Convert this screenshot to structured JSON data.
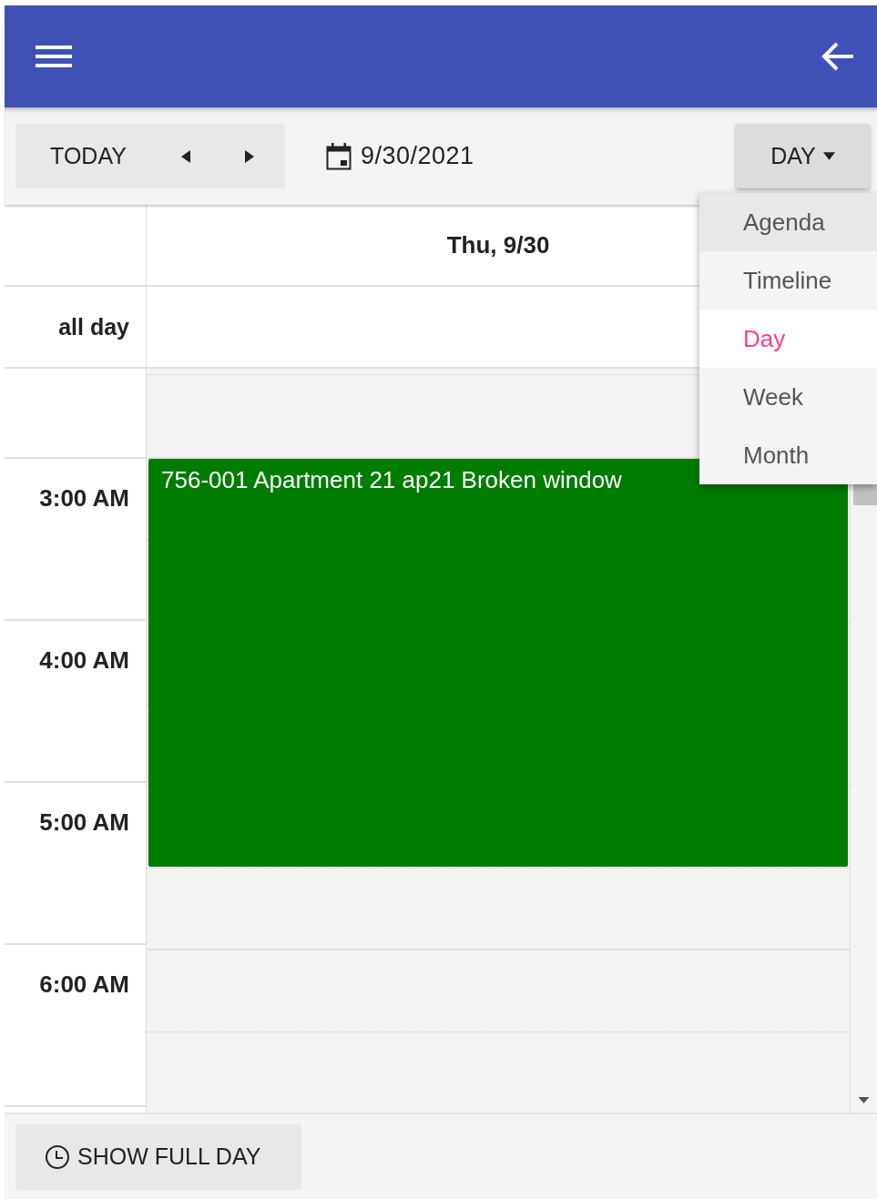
{
  "toolbar": {
    "today_label": "TODAY",
    "date": "9/30/2021",
    "view_label": "DAY"
  },
  "view_menu": [
    {
      "label": "Agenda",
      "selected": false,
      "hovered": true
    },
    {
      "label": "Timeline",
      "selected": false,
      "hovered": false
    },
    {
      "label": "Day",
      "selected": true,
      "hovered": false
    },
    {
      "label": "Week",
      "selected": false,
      "hovered": false
    },
    {
      "label": "Month",
      "selected": false,
      "hovered": false
    }
  ],
  "day_header": "Thu, 9/30",
  "all_day_label": "all day",
  "hours": [
    "3:00 AM",
    "4:00 AM",
    "5:00 AM",
    "6:00 AM"
  ],
  "events": [
    {
      "title": "756-001 Apartment 21 ap21 Broken window"
    }
  ],
  "footer": {
    "button_label": "SHOW FULL DAY"
  }
}
